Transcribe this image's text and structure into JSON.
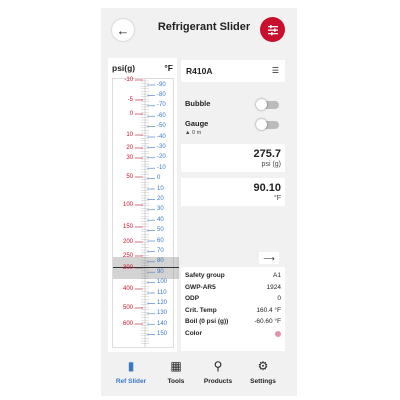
{
  "header": {
    "title": "Refrigerant Slider",
    "back_icon": "arrow-back-icon",
    "filter_icon": "tune-icon"
  },
  "scale": {
    "left_unit": "psi(g)",
    "right_unit": "°F",
    "pressure_ticks": [
      "-10",
      "-5",
      "0",
      "10",
      "20",
      "30",
      "50",
      "100",
      "150",
      "200",
      "250",
      "300",
      "400",
      "500",
      "600"
    ],
    "temp_ticks": [
      "-90",
      "-80",
      "-70",
      "-60",
      "-50",
      "-40",
      "-30",
      "-20",
      "-10",
      "0",
      "10",
      "20",
      "30",
      "40",
      "50",
      "60",
      "70",
      "80",
      "90",
      "100",
      "110",
      "120",
      "130",
      "140",
      "150"
    ]
  },
  "refrigerant": {
    "name": "R410A",
    "list_icon": "list-icon"
  },
  "toggles": {
    "bubble_label": "Bubble",
    "gauge_label": "Gauge",
    "altitude": "0 m"
  },
  "pressure": {
    "value": "275.7",
    "unit": "psi (g)"
  },
  "temperature": {
    "value": "90.10",
    "unit": "°F"
  },
  "properties": [
    {
      "key": "Safety group",
      "value": "A1"
    },
    {
      "key": "GWP-AR5",
      "value": "1924"
    },
    {
      "key": "ODP",
      "value": "0"
    },
    {
      "key": "Crit. Temp",
      "value": "160.4 °F"
    },
    {
      "key": "Boil (0 psi (g))",
      "value": "-60.60 °F"
    },
    {
      "key": "Color",
      "value": ""
    }
  ],
  "colors": {
    "accent": "#c8102e",
    "active_nav": "#3a78c9",
    "refrigerant_color": "#e38fb0"
  },
  "nav": [
    {
      "label": "Ref Slider",
      "icon": "ref-slider-icon"
    },
    {
      "label": "Tools",
      "icon": "grid-icon"
    },
    {
      "label": "Products",
      "icon": "search-icon"
    },
    {
      "label": "Settings",
      "icon": "gear-icon"
    }
  ]
}
